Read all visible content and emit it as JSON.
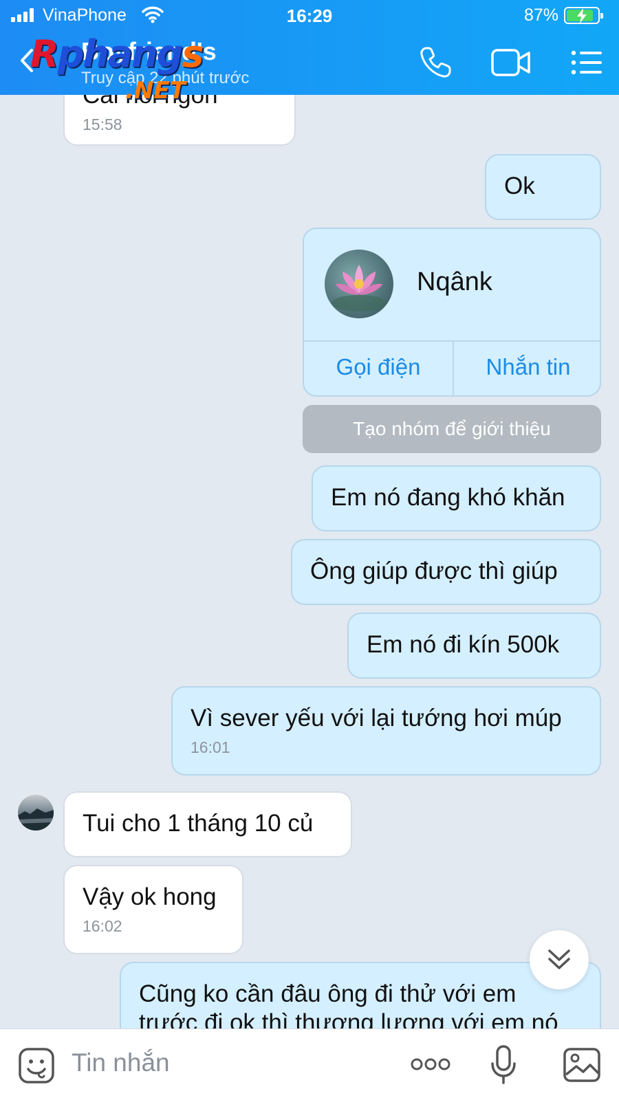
{
  "status_bar": {
    "carrier": "VinaPhone",
    "time": "16:29",
    "battery_percent": "87%",
    "battery_level": 0.87
  },
  "header": {
    "contact_name": "Boyfriend's",
    "contact_status": "Truy cập 22 phút trước",
    "watermark_main": "Rphangs",
    "watermark_sub": ".NET"
  },
  "messages": [
    {
      "id": "m1",
      "side": "in",
      "text": "Cái nồi ngon",
      "time": "15:58"
    },
    {
      "id": "m2",
      "side": "out",
      "text": "Ok"
    },
    {
      "id": "m3",
      "side": "out",
      "type": "contact_card",
      "name": "Nqânk",
      "call_label": "Gọi điện",
      "message_label": "Nhắn tin"
    },
    {
      "id": "m4",
      "side": "out",
      "type": "action",
      "text": "Tạo nhóm để giới thiệu"
    },
    {
      "id": "m5",
      "side": "out",
      "text": "Em nó đang khó khăn"
    },
    {
      "id": "m6",
      "side": "out",
      "text": "Ông giúp được thì giúp"
    },
    {
      "id": "m7",
      "side": "out",
      "text": "Em nó đi kín 500k"
    },
    {
      "id": "m8",
      "side": "out",
      "text": "Vì sever yếu với lại tướng hơi múp",
      "time": "16:01"
    },
    {
      "id": "m9",
      "side": "in",
      "text": "Tui cho 1 tháng 10 củ"
    },
    {
      "id": "m10",
      "side": "in",
      "text": "Vậy ok hong",
      "time": "16:02"
    },
    {
      "id": "m11",
      "side": "out",
      "text": "Cũng ko cần đâu ông đi thử với em",
      "text2": "trước đi ok thì thương lượng với em nó"
    }
  ],
  "composer": {
    "placeholder": "Tin nhắn"
  },
  "icons": {
    "back": "chevron-left-icon",
    "call": "phone-icon",
    "video": "video-camera-icon",
    "menu": "list-menu-icon",
    "emoji": "sticker-face-icon",
    "more": "more-dots-icon",
    "mic": "microphone-icon",
    "image": "image-icon",
    "scroll": "double-chevron-down-icon"
  },
  "colors": {
    "header": "#1d8cf4",
    "outgoing_bubble": "#d4efff",
    "incoming_bubble": "#ffffff",
    "chat_background": "#e2e9f1",
    "link_blue": "#1a8be6"
  }
}
